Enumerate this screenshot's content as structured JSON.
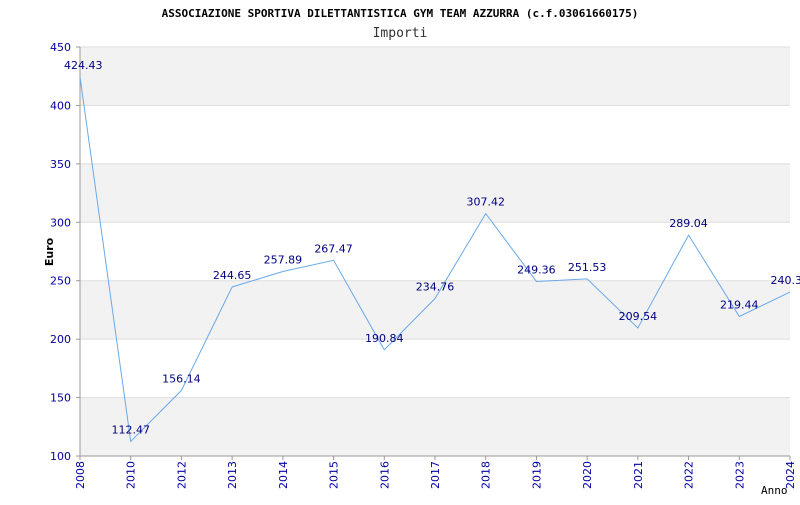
{
  "chart_data": {
    "type": "line",
    "title": "ASSOCIAZIONE SPORTIVA DILETTANTISTICA GYM TEAM AZZURRA (c.f.03061660175)",
    "subtitle": "Importi",
    "ylabel": "Euro",
    "xlabel": "Anno",
    "categories": [
      "2008",
      "2010",
      "2012",
      "2013",
      "2014",
      "2015",
      "2016",
      "2017",
      "2018",
      "2019",
      "2020",
      "2021",
      "2022",
      "2023",
      "2024"
    ],
    "values": [
      424.43,
      112.47,
      156.14,
      244.65,
      257.89,
      267.47,
      190.84,
      234.76,
      307.42,
      249.36,
      251.53,
      209.54,
      289.04,
      219.44,
      240.3
    ],
    "value_labels": [
      "424.43",
      "112.47",
      "156.14",
      "244.65",
      "257.89",
      "267.47",
      "190.84",
      "234.76",
      "307.42",
      "249.36",
      "251.53",
      "209.54",
      "289.04",
      "219.44",
      "240.3"
    ],
    "ylim": [
      100,
      450
    ],
    "yticks": [
      "100",
      "150",
      "200",
      "250",
      "300",
      "350",
      "400",
      "450"
    ],
    "grid": true,
    "colors": {
      "line": "#6aa9e8",
      "band": "#f2f2f2",
      "tick_text": "#0000a0",
      "label_text": "#000080"
    }
  }
}
